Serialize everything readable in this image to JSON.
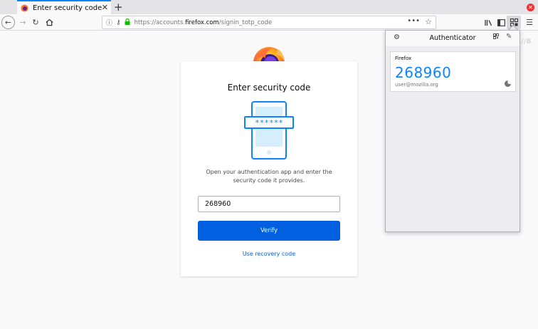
{
  "tab": {
    "title": "Enter security code"
  },
  "toolbar": {
    "url_prefix": "https://accounts.",
    "url_host": "firefox.com",
    "url_path": "/signin_totp_code",
    "more_label": "•••"
  },
  "page": {
    "title": "Enter security code",
    "phone_mask": "******",
    "instructions": "Open your authentication app and enter the security code it provides.",
    "code_value": "268960",
    "verify_label": "Verify",
    "recovery_label": "Use recovery code"
  },
  "popup": {
    "title": "Authenticator",
    "entry": {
      "issuer": "Firefox",
      "code": "268960",
      "account": "user@mozilla.org"
    }
  },
  "colors": {
    "accent": "#0060df",
    "code_blue": "#0a84ff",
    "lock_green": "#12bc00"
  }
}
